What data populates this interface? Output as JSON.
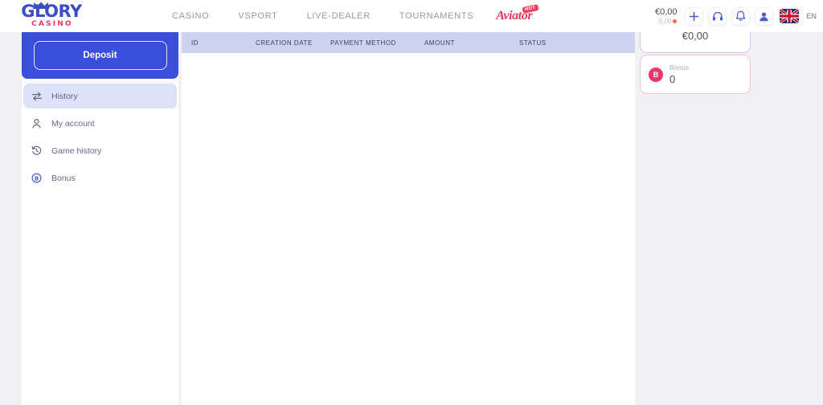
{
  "header": {
    "logo": {
      "main": "GLORY",
      "sub": "CASINO",
      "crown_icon": "crown-icon"
    },
    "nav": [
      {
        "label": "CASINO",
        "name": "nav-casino"
      },
      {
        "label": "VSPORT",
        "name": "nav-vsport"
      },
      {
        "label": "LIVE-DEALER",
        "name": "nav-live-dealer"
      },
      {
        "label": "TOURNAMENTS",
        "name": "nav-tournaments"
      }
    ],
    "aviator": {
      "label": "Aviator",
      "badge": "HOT"
    },
    "balance": {
      "main": "€0,00",
      "sub": "0,00"
    },
    "icons": [
      {
        "name": "plus-icon",
        "glyph": "+"
      },
      {
        "name": "headset-icon",
        "glyph": "headset"
      },
      {
        "name": "bell-icon",
        "glyph": "bell"
      },
      {
        "name": "user-avatar-icon",
        "glyph": "user"
      }
    ],
    "language": {
      "label": "EN",
      "flag": "uk-flag-icon"
    }
  },
  "sidebar": {
    "deposit_label": "Deposit",
    "items": [
      {
        "label": "History",
        "icon": "transfer-arrows-icon",
        "active": true
      },
      {
        "label": "My account",
        "icon": "user-icon",
        "active": false
      },
      {
        "label": "Game history",
        "icon": "clock-history-icon",
        "active": false
      },
      {
        "label": "Bonus",
        "icon": "bonus-circle-icon",
        "active": false
      }
    ]
  },
  "table": {
    "columns": [
      "ID",
      "CREATION DATE",
      "PAYMENT METHOD",
      "AMOUNT",
      "STATUS"
    ],
    "rows": []
  },
  "right_panel": {
    "balance_card": {
      "value": "€0,00"
    },
    "bonus_card": {
      "badge": "B",
      "label": "Bonus",
      "value": "0"
    }
  },
  "colors": {
    "brand_blue": "#3b4ddb",
    "brand_pink": "#e8366b",
    "page_bg": "#f1f1f4",
    "table_head_bg": "#ccd2f0",
    "active_item_bg": "#dde2f7"
  }
}
